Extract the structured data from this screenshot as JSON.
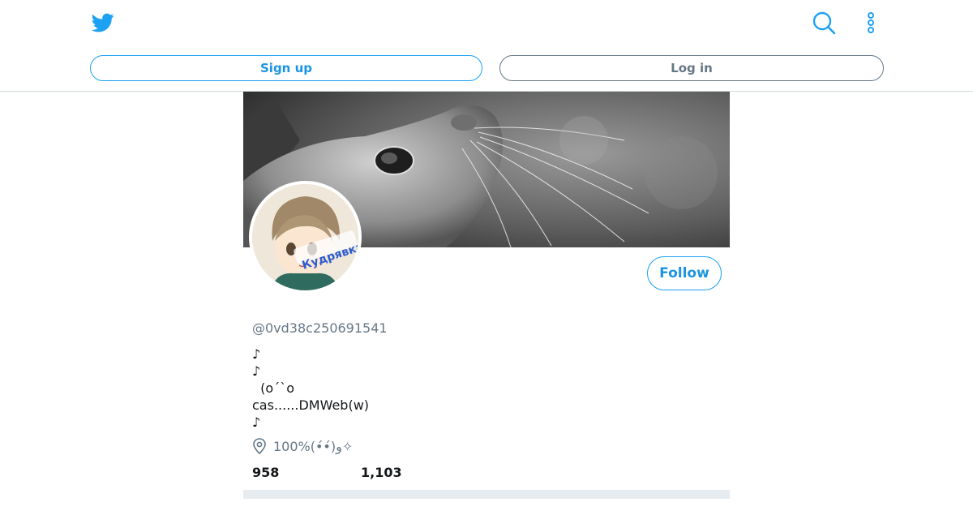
{
  "header": {
    "logo_icon": "twitter-bird-icon",
    "search_icon": "search-icon",
    "more_icon": "more-vertical-icon",
    "signup_label": "Sign up",
    "login_label": "Log in",
    "accent_color": "#1da1f2"
  },
  "profile": {
    "banner_image": "grayscale-cat-photo",
    "avatar_image": "anime-avatar",
    "avatar_caption": "Кудрявка",
    "follow_label": "Follow",
    "handle": "@0vd38c250691541",
    "bio": "♪\n♪\n  (o´`o\ncas......DMWeb(w)\n♪",
    "location": "100%(•́•́)و✧",
    "stats": [
      "958",
      "1,103"
    ]
  }
}
